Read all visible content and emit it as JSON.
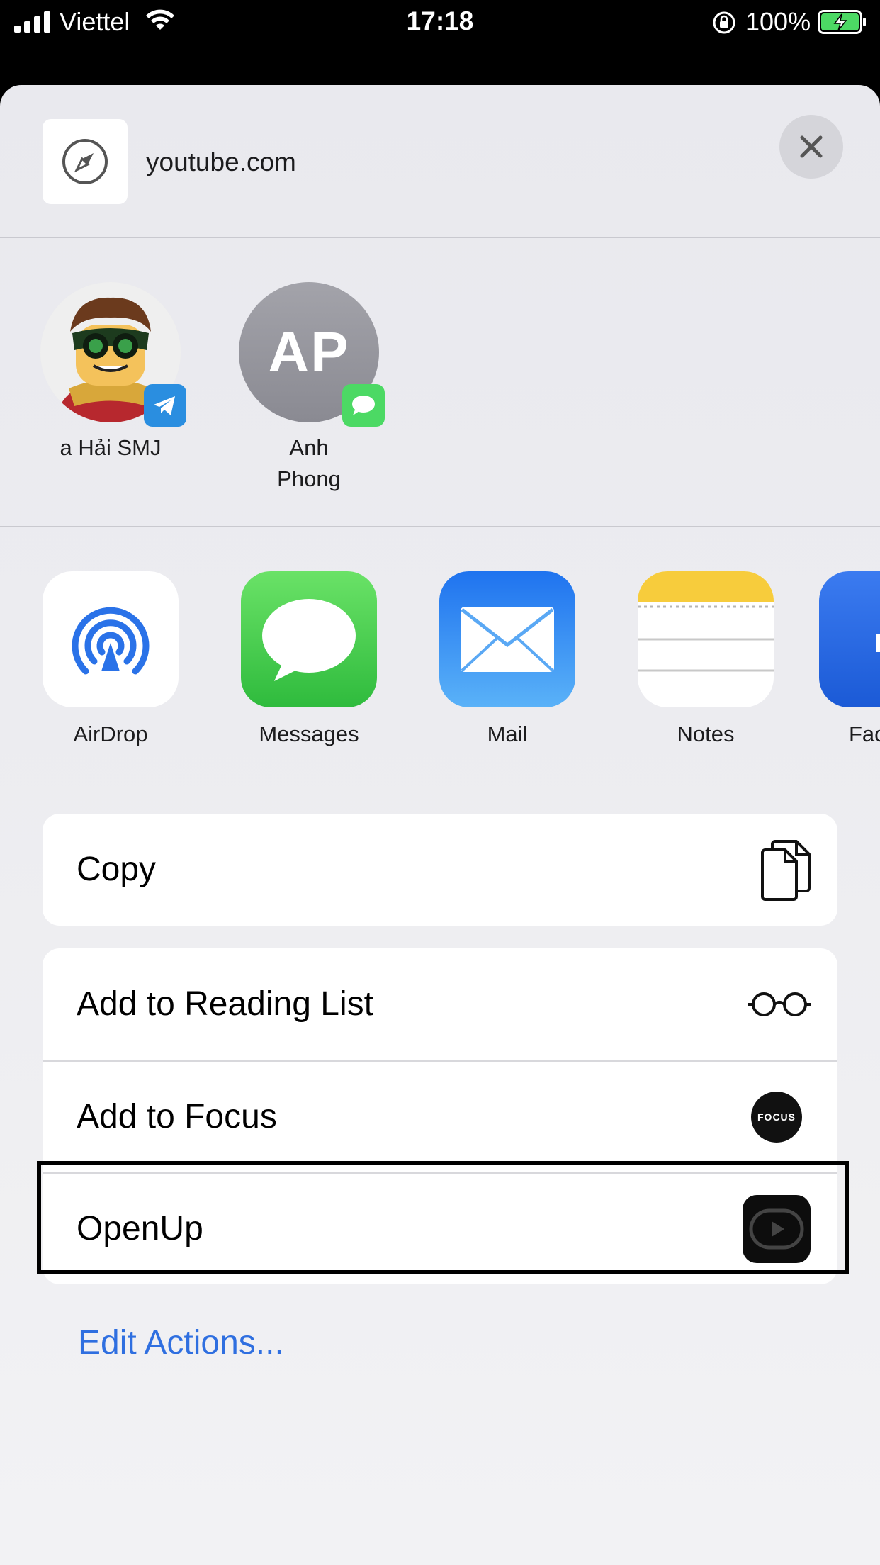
{
  "status_bar": {
    "carrier": "Viettel",
    "time": "17:18",
    "battery_percent": "100%"
  },
  "share_header": {
    "site_title": "youtube.com"
  },
  "contacts": [
    {
      "name": "a Hải SMJ",
      "badge": "telegram-icon"
    },
    {
      "name": "Anh\nPhong",
      "initials": "AP",
      "badge": "messages-icon"
    }
  ],
  "apps": [
    {
      "label": "AirDrop"
    },
    {
      "label": "Messages"
    },
    {
      "label": "Mail"
    },
    {
      "label": "Notes"
    },
    {
      "label": "Fac"
    }
  ],
  "actions_group1": [
    {
      "label": "Copy",
      "icon": "copy-icon"
    }
  ],
  "actions_group2": [
    {
      "label": "Add to Reading List",
      "icon": "glasses-icon"
    },
    {
      "label": "Add to Focus",
      "icon": "focus-icon",
      "icon_text": "FOCUS"
    },
    {
      "label": "OpenUp",
      "icon": "openup-icon"
    }
  ],
  "edit_actions_label": "Edit Actions...",
  "colors": {
    "accent_blue": "#2f6fe0",
    "messages_green": "#4cd964",
    "telegram_blue": "#2a8ee0"
  }
}
